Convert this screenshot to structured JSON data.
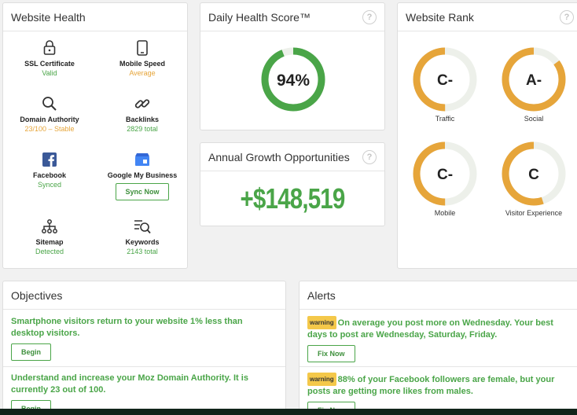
{
  "health": {
    "title": "Website Health",
    "items": [
      {
        "icon": "lock-icon",
        "label": "SSL Certificate",
        "status": "Valid",
        "status_color": "green"
      },
      {
        "icon": "mobile-icon",
        "label": "Mobile Speed",
        "status": "Average",
        "status_color": "amber"
      },
      {
        "icon": "search-icon",
        "label": "Domain Authority",
        "status_a": "23/100",
        "status_b": " – Stable"
      },
      {
        "icon": "link-icon",
        "label": "Backlinks",
        "status": "2829 total",
        "status_color": "green"
      },
      {
        "icon": "facebook-icon",
        "label": "Facebook",
        "status": "Synced",
        "status_color": "green"
      },
      {
        "icon": "google-my-business-icon",
        "label": "Google My Business",
        "button": "Sync Now"
      },
      {
        "icon": "sitemap-icon",
        "label": "Sitemap",
        "status": "Detected",
        "status_color": "green"
      },
      {
        "icon": "keywords-icon",
        "label": "Keywords",
        "status": "2143 total",
        "status_color": "green"
      }
    ]
  },
  "score": {
    "title": "Daily Health Score™",
    "value": "94%",
    "percent": 94,
    "help": "?"
  },
  "growth": {
    "title": "Annual Growth Opportunities",
    "value": "+$148,519",
    "help": "?"
  },
  "rank": {
    "title": "Website Rank",
    "help": "?",
    "items": [
      {
        "grade": "C-",
        "label": "Traffic",
        "fill": 0.5
      },
      {
        "grade": "A-",
        "label": "Social",
        "fill": 0.85
      },
      {
        "grade": "C-",
        "label": "Mobile",
        "fill": 0.5
      },
      {
        "grade": "C",
        "label": "Visitor Experience",
        "fill": 0.55
      }
    ]
  },
  "objectives": {
    "title": "Objectives",
    "items": [
      {
        "text": "Smartphone visitors return to your website 1% less than desktop visitors.",
        "button": "Begin"
      },
      {
        "text": "Understand and increase your Moz Domain Authority. It is currently 23 out of 100.",
        "button": "Begin"
      }
    ]
  },
  "alerts": {
    "title": "Alerts",
    "items": [
      {
        "badge": "warning",
        "text": "On average you post more on Wednesday. Your best days to post are Wednesday, Saturday, Friday.",
        "button": "Fix Now"
      },
      {
        "badge": "warning",
        "text": "88% of your Facebook followers are female, but your posts are getting more likes from males.",
        "button": "Fix Now"
      }
    ]
  },
  "colors": {
    "green": "#4aa548",
    "amber": "#e6a53a",
    "ring_bg": "#edf0ea"
  }
}
